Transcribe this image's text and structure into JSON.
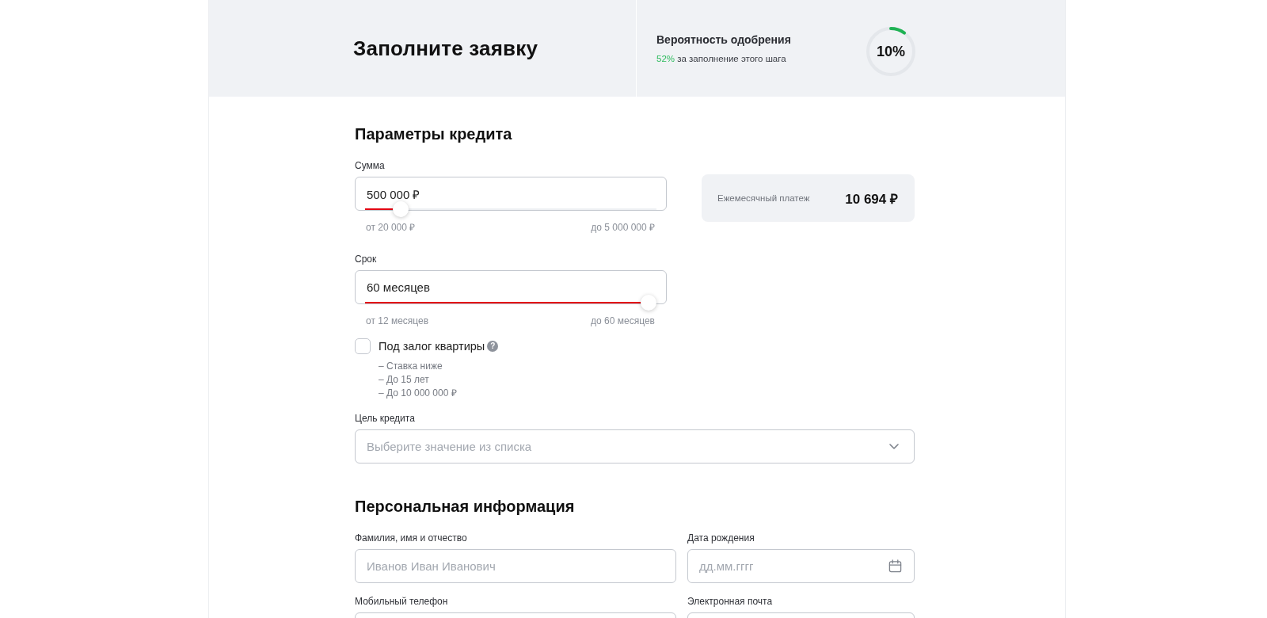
{
  "header": {
    "title": "Заполните заявку",
    "approval": {
      "title": "Вероятность одобрения",
      "gain": "52%",
      "gain_text": "за заполнение этого шага",
      "level": 0.1,
      "reading": "10%"
    }
  },
  "credit": {
    "heading": "Параметры кредита",
    "sliders": [
      {
        "label": "Сумма",
        "value": "500 000 ₽",
        "level": 0.1,
        "min": "от 20 000 ₽",
        "max": "до 5 000 000 ₽"
      },
      {
        "label": "Срок",
        "value": "60 месяцев",
        "level": 1,
        "min": "от 12 месяцев",
        "max": "до 60 месяцев"
      }
    ],
    "payment": {
      "label": "Ежемесячный платеж",
      "value": "10 694 ₽"
    },
    "collateral": {
      "label": "Под залог квартиры",
      "hint": "?",
      "checked": false,
      "benefits": [
        "– Ставка ниже",
        "– До 15 лет",
        "– До 10 000 000 ₽"
      ]
    },
    "purpose": {
      "label": "Цель кредита",
      "placeholder": "Выберите значение из списка"
    }
  },
  "personal": {
    "heading": "Персональная информация",
    "fields": [
      {
        "kind": "text",
        "label": "Фамилия, имя и отчество",
        "placeholder": "Иванов Иван Иванович"
      },
      {
        "kind": "date",
        "label": "Дата рождения",
        "placeholder": "дд.мм.гггг"
      },
      {
        "kind": "text",
        "label": "Мобильный телефон"
      },
      {
        "kind": "text",
        "label": "Электронная почта"
      }
    ]
  }
}
